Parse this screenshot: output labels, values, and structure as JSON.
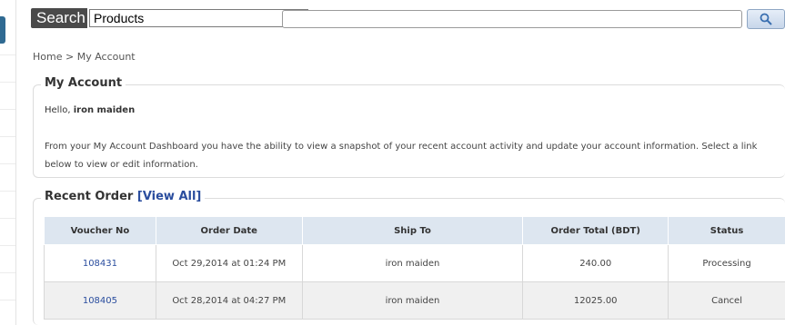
{
  "search": {
    "label": "Search",
    "category": "Products",
    "query": "",
    "button_icon": "search-icon"
  },
  "breadcrumb": {
    "home": "Home",
    "separator": ">",
    "current": "My Account"
  },
  "account": {
    "title": "My Account",
    "greeting_prefix": "Hello,",
    "user_name": "iron maiden",
    "description": "From your My Account Dashboard you have the ability to view a snapshot of your recent account activity and update your account information. Select a link below to view or edit information."
  },
  "orders": {
    "title": "Recent Order",
    "view_all": "[View All]",
    "columns": [
      "Voucher No",
      "Order Date",
      "Ship To",
      "Order Total (BDT)",
      "Status"
    ],
    "rows": [
      [
        "108431",
        "Oct 29,2014 at 01:24 PM",
        "iron maiden",
        "240.00",
        "Processing"
      ],
      [
        "108405",
        "Oct 28,2014 at 04:27 PM",
        "iron maiden",
        "12025.00",
        "Cancel"
      ]
    ]
  },
  "colors": {
    "accent": "#2a4d9e",
    "header_bg": "#dde6f0",
    "search_label_bg": "#4a4a4a"
  }
}
